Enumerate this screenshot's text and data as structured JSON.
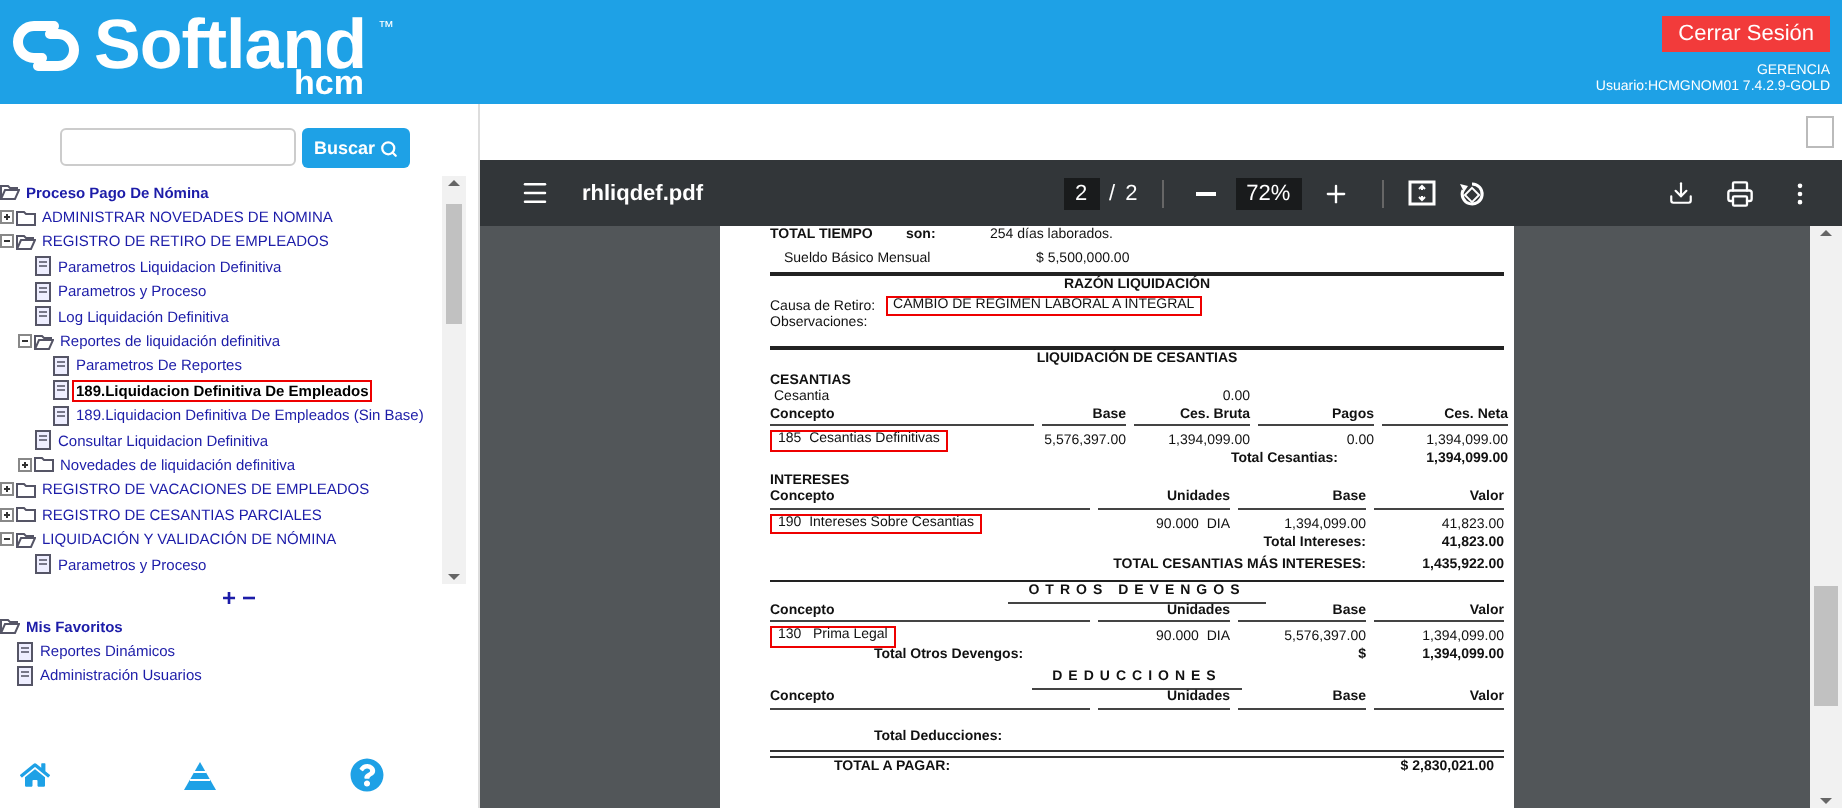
{
  "header": {
    "logo": {
      "name": "Softland",
      "trademark": "™",
      "product": "hcm"
    },
    "logout_button": "Cerrar Sesión",
    "role": "GERENCIA",
    "user": "Usuario:HCMGNOM01 7.4.2.9-GOLD"
  },
  "sidebar": {
    "search_button": "Buscar",
    "tree": {
      "label": "Proceso Pago De Nómina",
      "children": [
        {
          "label": "ADMINISTRAR NOVEDADES DE NOMINA",
          "kind": "folder",
          "expanded": false,
          "selected": false
        },
        {
          "label": "REGISTRO DE RETIRO DE EMPLEADOS",
          "kind": "folder",
          "expanded": true,
          "selected": false,
          "children": [
            {
              "label": "Parametros Liquidacion Definitiva",
              "kind": "doc",
              "selected": false
            },
            {
              "label": "Parametros y Proceso",
              "kind": "doc",
              "selected": false
            },
            {
              "label": "Log Liquidación Definitiva",
              "kind": "doc",
              "selected": false
            },
            {
              "label": "Reportes de liquidación definitiva",
              "kind": "folder",
              "expanded": true,
              "selected": false,
              "children": [
                {
                  "label": "Parametros De Reportes",
                  "kind": "doc",
                  "selected": false
                },
                {
                  "label": "189.Liquidacion Definitiva De Empleados",
                  "kind": "doc",
                  "selected": true
                },
                {
                  "label": "189.Liquidacion Definitiva De Empleados (Sin Base)",
                  "kind": "doc",
                  "selected": false
                }
              ]
            },
            {
              "label": "Consultar Liquidacion Definitiva",
              "kind": "doc",
              "selected": false
            },
            {
              "label": "Novedades de liquidación definitiva",
              "kind": "folder",
              "expanded": false,
              "selected": false
            }
          ]
        },
        {
          "label": "REGISTRO DE VACACIONES DE EMPLEADOS",
          "kind": "folder",
          "expanded": false,
          "selected": false
        },
        {
          "label": "REGISTRO DE CESANTIAS PARCIALES",
          "kind": "folder",
          "expanded": false,
          "selected": false
        },
        {
          "label": "LIQUIDACIÓN Y VALIDACIÓN DE NÓMINA",
          "kind": "folder",
          "expanded": true,
          "selected": false,
          "children": [
            {
              "label": "Parametros y Proceso",
              "kind": "doc",
              "selected": false
            }
          ]
        }
      ]
    },
    "tree_controls": [
      "+",
      "−"
    ],
    "favorites": {
      "label": "Mis Favoritos",
      "children": [
        {
          "label": "Reportes Dinámicos",
          "kind": "doc",
          "selected": false
        },
        {
          "label": "Administración Usuarios",
          "kind": "doc",
          "selected": false
        }
      ]
    }
  },
  "viewer": {
    "filename": "rhliqdef.pdf",
    "page": "2",
    "page_separator": "/",
    "total_pages": "2",
    "zoom": "72%"
  },
  "report": {
    "tiempo": {
      "label": "TOTAL TIEMPO",
      "son": "son:",
      "days": "254 días laborados.",
      "salary_label": "Sueldo Básico Mensual",
      "salary": "$ 5,500,000.00"
    },
    "razon": {
      "title": "RAZÓN LIQUIDACIÓN",
      "cause_label": "Causa de Retiro:",
      "cause": "CAMBIO DE REGIMEN LABORAL A INTEGRAL",
      "cause_highlighted": true,
      "obs_label": "Observaciones:"
    },
    "cesantias": {
      "title": "LIQUIDACIÓN DE CESANTIAS",
      "section": "CESANTIAS",
      "cesantia_label": "Cesantia",
      "cesantia_value": "0.00",
      "columns": [
        "Concepto",
        "Base",
        "Ces. Bruta",
        "Pagos",
        "Ces. Neta"
      ],
      "rows": [
        {
          "cells": [
            "185  Cesantias Definitivas",
            "5,576,397.00",
            "1,394,099.00",
            "0.00",
            "1,394,099.00"
          ],
          "highlighted": true
        }
      ],
      "total_label": "Total Cesantias:",
      "total": "1,394,099.00"
    },
    "intereses": {
      "section": "INTERESES",
      "columns": [
        "Concepto",
        "Unidades",
        "Base",
        "Valor"
      ],
      "rows": [
        {
          "cells": [
            "190  Intereses Sobre Cesantias",
            "90.000  DIA",
            "1,394,099.00",
            "41,823.00"
          ],
          "highlighted": true
        }
      ],
      "total_label": "Total Intereses:",
      "total": "41,823.00",
      "grand_label": "TOTAL CESANTIAS MÁS INTERESES:",
      "grand_total": "1,435,922.00"
    },
    "otros_devengos": {
      "title": "OTROS DEVENGOS",
      "columns": [
        "Concepto",
        "Unidades",
        "Base",
        "Valor"
      ],
      "rows": [
        {
          "cells": [
            "130   Prima Legal",
            "90.000  DIA",
            "5,576,397.00",
            "1,394,099.00"
          ],
          "highlighted": true
        }
      ],
      "total_label": "Total Otros Devengos:",
      "currency": "$",
      "total": "1,394,099.00"
    },
    "deducciones": {
      "title": "DEDUCCIONES",
      "columns": [
        "Concepto",
        "Unidades",
        "Base",
        "Valor"
      ],
      "total_label": "Total Deducciones:"
    },
    "total_a_pagar": {
      "label": "TOTAL A PAGAR:",
      "value": "$ 2,830,021.00"
    }
  }
}
